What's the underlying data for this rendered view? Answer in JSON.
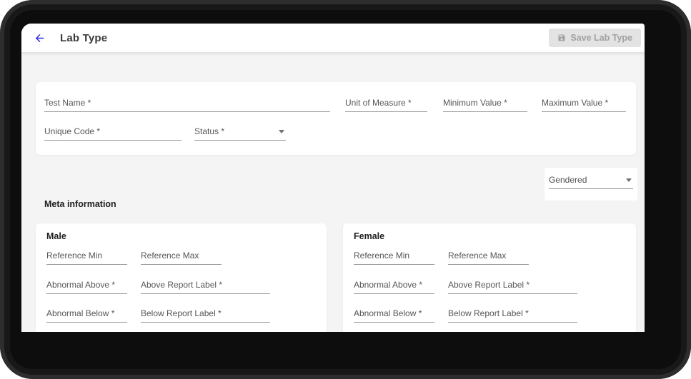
{
  "header": {
    "title": "Lab Type",
    "save_button_label": "Save Lab Type"
  },
  "icons": {
    "back": "arrow-left-icon",
    "save": "save-icon",
    "select": "dropdown-arrow-icon"
  },
  "colors": {
    "accent_blue": "#2d2de6",
    "frame_black": "#0d0d0d",
    "page_background": "#f4f4f4",
    "card_background": "#ffffff",
    "disabled_button_bg": "#e3e3e3",
    "disabled_button_text": "#a1a1a1",
    "field_label": "#565656",
    "field_underline": "#9b9b9b"
  },
  "form": {
    "fields": {
      "test_name": "Test Name *",
      "unit_of_measure": "Unit of Measure *",
      "minimum_value": "Minimum Value *",
      "maximum_value": "Maximum Value *",
      "unique_code": "Unique Code *",
      "status": "Status *"
    },
    "gendered_select_value": "Gendered",
    "meta_section_title": "Meta information",
    "gender_cards": [
      {
        "title": "Male",
        "fields": {
          "reference_min": "Reference Min",
          "reference_max": "Reference Max",
          "abnormal_above": "Abnormal Above *",
          "above_report_label": "Above Report Label *",
          "abnormal_below": "Abnormal Below *",
          "below_report_label": "Below Report Label *"
        }
      },
      {
        "title": "Female",
        "fields": {
          "reference_min": "Reference Min",
          "reference_max": "Reference Max",
          "abnormal_above": "Abnormal Above *",
          "above_report_label": "Above Report Label *",
          "abnormal_below": "Abnormal Below *",
          "below_report_label": "Below Report Label *"
        }
      }
    ]
  }
}
